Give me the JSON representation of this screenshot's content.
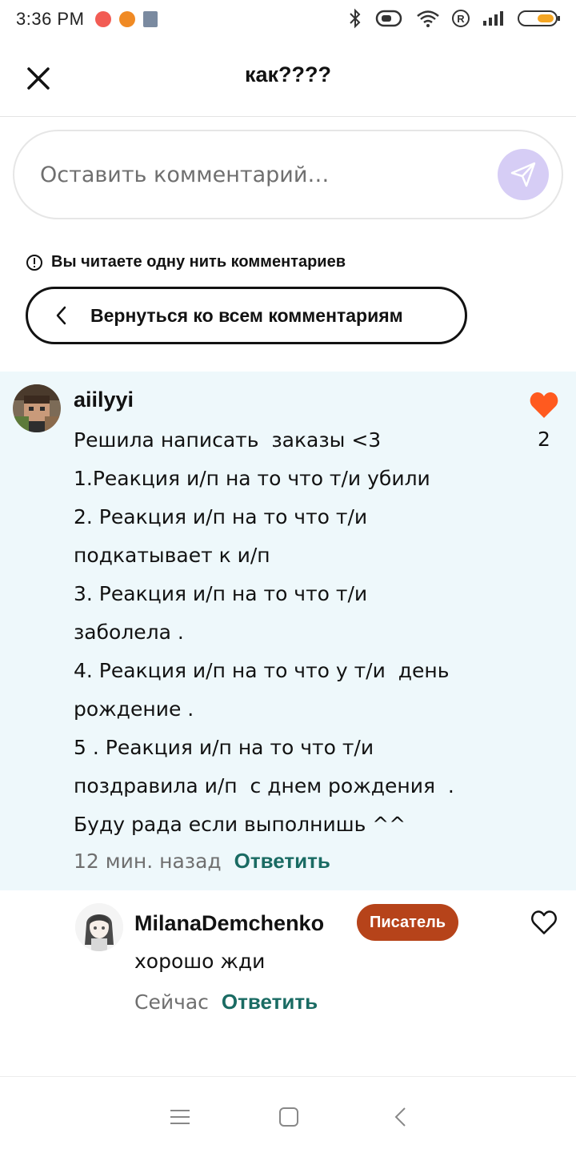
{
  "status_bar": {
    "time": "3:36 PM",
    "icons": [
      "music-app-icon",
      "notification-app-icon",
      "calculator-app-icon",
      "bluetooth-icon",
      "vibrate-icon",
      "wifi-icon",
      "registered-icon",
      "signal-icon",
      "battery-icon"
    ]
  },
  "header": {
    "title": "как????"
  },
  "comment_input": {
    "placeholder": "Оставить комментарий…"
  },
  "thread": {
    "notice": "Вы читаете одну нить комментариев",
    "back_label": "Вернуться ко всем комментариям"
  },
  "main_comment": {
    "author": "aiilyyi",
    "lines": [
      "Решила написать  заказы <3",
      "1.Реакция и/п на то что т/и убили",
      "2. Реакция и/п на то что т/и",
      "подкатывает к и/п",
      "3. Реакция и/п на то что т/и",
      "заболела .",
      "4. Реакция и/п на то что у т/и  день",
      "рождение .",
      "5 . Реакция и/п на то что т/и",
      "поздравила и/п  с днем рождения  .",
      "Буду рада если выполнишь ^^"
    ],
    "time": "12 мин. назад",
    "reply_label": "Ответить",
    "likes": "2",
    "liked": true
  },
  "reply_comment": {
    "author": "MilanaDemchenko",
    "badge": "Писатель",
    "text": "хорошо жди",
    "time": "Сейчас",
    "reply_label": "Ответить",
    "liked": false
  },
  "colors": {
    "accent_teal": "#1a6b63",
    "like_orange": "#ff5a1f",
    "badge_bg": "#b6431a",
    "thread_bg": "#eef8fb",
    "send_bg": "#d6cdf5"
  }
}
